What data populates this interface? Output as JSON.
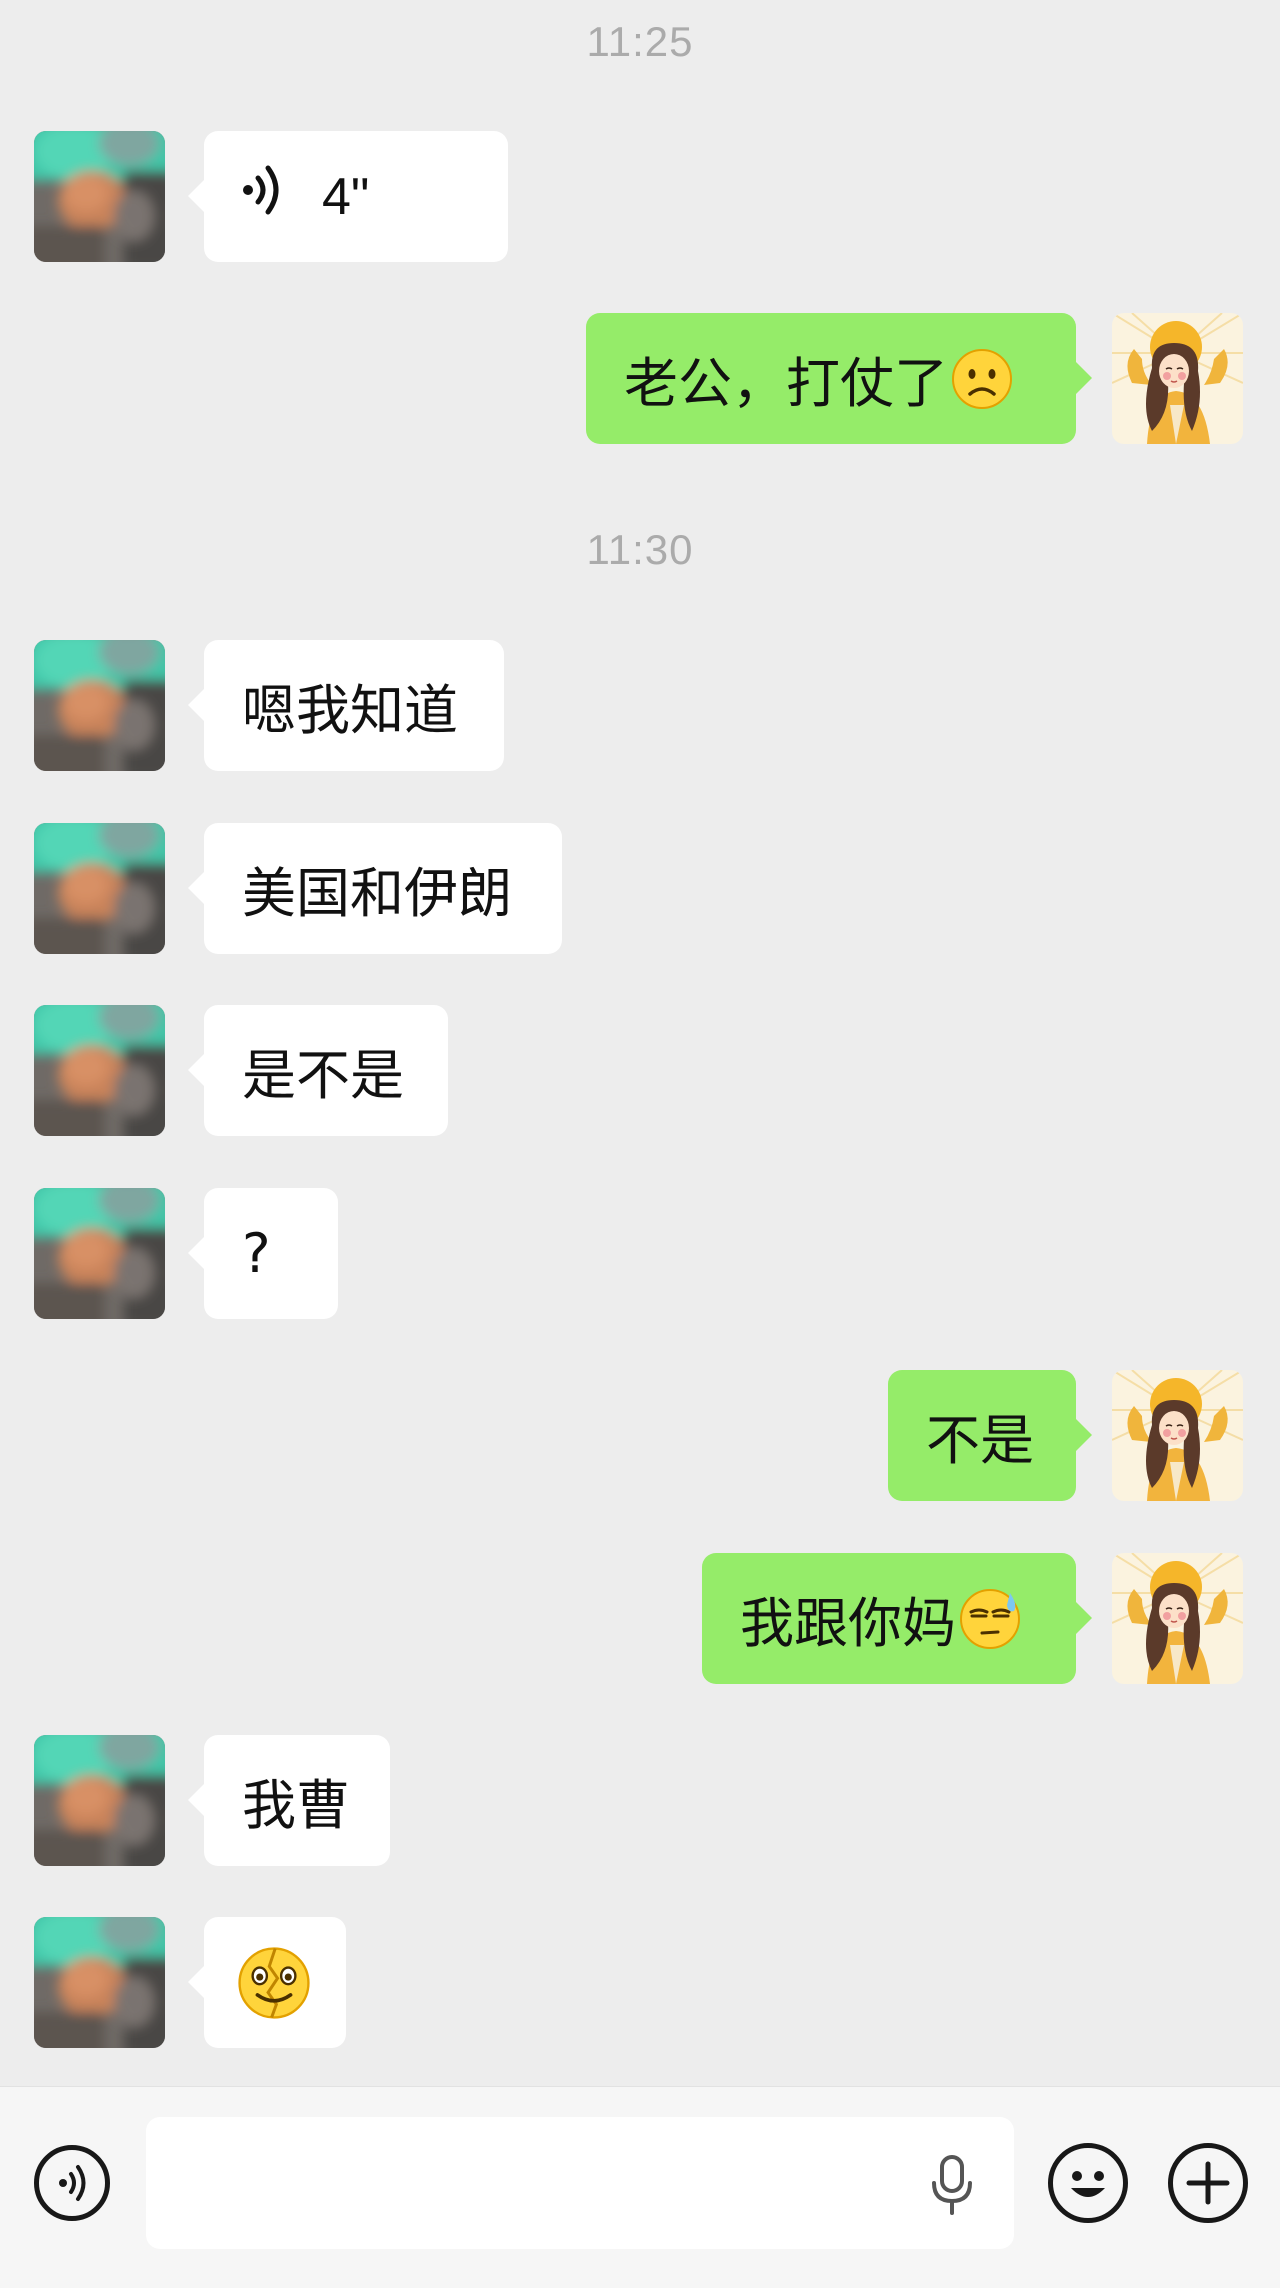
{
  "timestamps": [
    "11:25",
    "11:30"
  ],
  "messages": [
    {
      "side": "left",
      "type": "voice",
      "duration": "4\""
    },
    {
      "side": "right",
      "type": "text",
      "text": "老公，打仗了",
      "emoji": "frowning-face-emoji"
    },
    {
      "side": "left",
      "type": "text",
      "text": "嗯我知道"
    },
    {
      "side": "left",
      "type": "text",
      "text": "美国和伊朗"
    },
    {
      "side": "left",
      "type": "text",
      "text": "是不是"
    },
    {
      "side": "left",
      "type": "text",
      "text": "?"
    },
    {
      "side": "right",
      "type": "text",
      "text": "不是"
    },
    {
      "side": "right",
      "type": "text",
      "text": "我跟你妈",
      "emoji": "sweat-rolling-eyes-emoji"
    },
    {
      "side": "left",
      "type": "text",
      "text": "我曹"
    },
    {
      "side": "left",
      "type": "emoji",
      "emoji": "cracked-smile-emoji"
    }
  ],
  "colors": {
    "background": "#EDEDED",
    "sent_bubble": "#95EC69",
    "received_bubble": "#FFFFFF",
    "timestamp": "#ABABAB",
    "input_bar": "#F6F6F6"
  },
  "input_bar": {
    "input_value": "",
    "icons": [
      "voice-mode-icon",
      "microphone-icon",
      "emoji-face-icon",
      "plus-icon"
    ]
  }
}
